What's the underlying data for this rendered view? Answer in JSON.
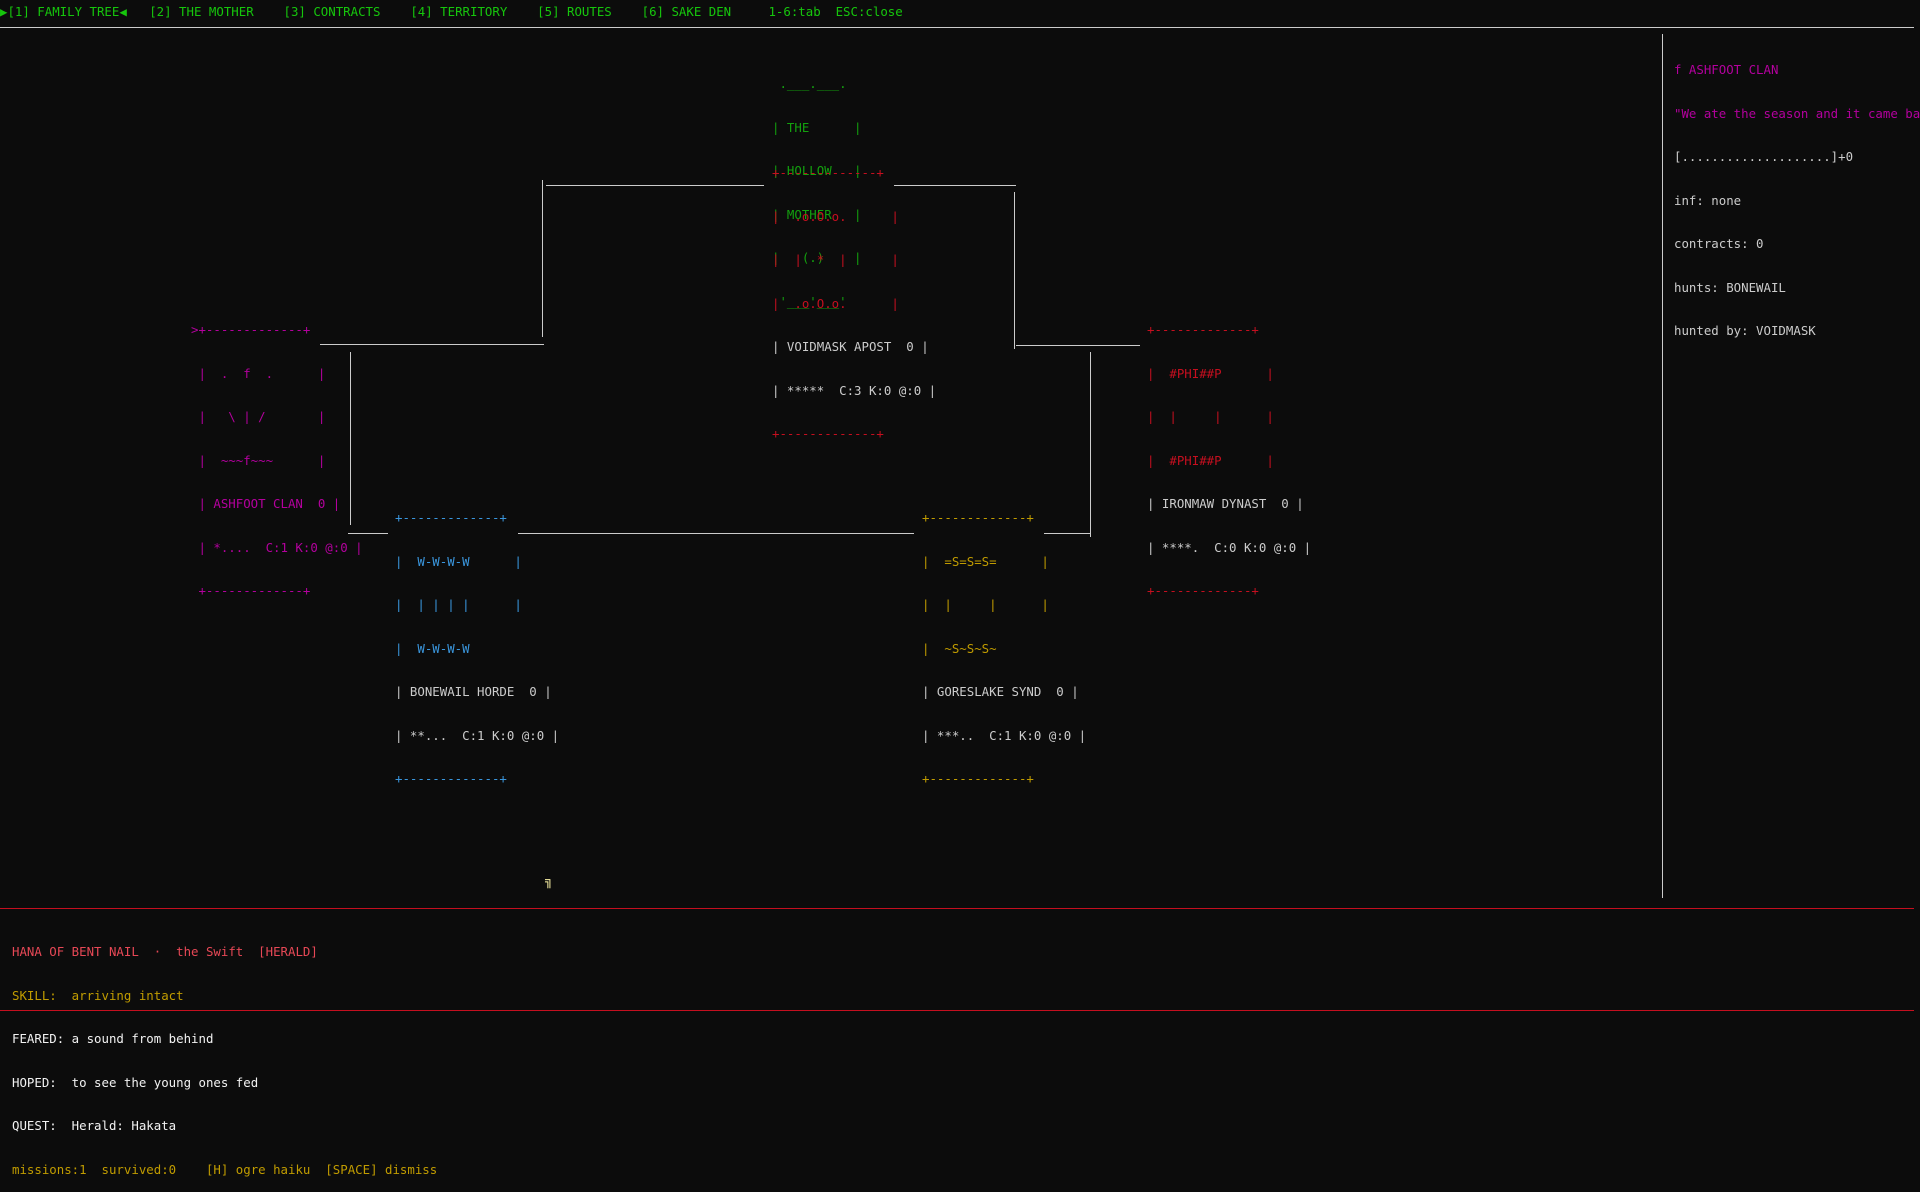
{
  "tabs": {
    "family_tree": "▶[1] FAMILY TREE◀",
    "mother": "[2] THE MOTHER",
    "contracts": "[3] CONTRACTS",
    "territory": "[4] TERRITORY",
    "routes": "[5] ROUTES",
    "sake_den": "[6] SAKE DEN",
    "hint": "1-6:tab  ESC:close"
  },
  "mother_art": [
    " .___.___.",
    "| THE      |",
    "| HOLLOW   |",
    "| MOTHER   |",
    "|   (.)    |",
    " '___'___'"
  ],
  "clans": {
    "voidmask": {
      "art": [
        "+-------------+",
        "|  .o.O.o.      |",
        "|  |  *  |      |",
        "|  .o.O.o.      |"
      ],
      "name_line": "| VOIDMASK APOST  0 |",
      "stats_line": "| *****  C:3 K:0 @:0 |",
      "bottom": "+-------------+"
    },
    "ashfoot": {
      "art": [
        ">+-------------+",
        " |  .  f  .      |",
        " |   \\ | /       |",
        " |  ~~~f~~~      |"
      ],
      "name_line": " | ASHFOOT CLAN  0 |",
      "stats_line": " | *....  C:1 K:0 @:0 |",
      "bottom": " +-------------+"
    },
    "ironmaw": {
      "art": [
        "+-------------+",
        "|  #PHI##P      |",
        "|  |     |      |",
        "|  #PHI##P      |"
      ],
      "name_line": "| IRONMAW DYNAST  0 |",
      "stats_line": "| ****.  C:0 K:0 @:0 |",
      "bottom": "+-------------+"
    },
    "bonewail": {
      "art": [
        "+-------------+",
        "|  W-W-W-W      |",
        "|  | | | |      |",
        "|  W-W-W-W      "
      ],
      "name_line": "| BONEWAIL HORDE  0 |",
      "stats_line": "| **...  C:1 K:0 @:0 |",
      "bottom": "+-------------+"
    },
    "goreslake": {
      "art": [
        "+-------------+",
        "|  =S=S=S=      |",
        "|  |     |      |",
        "|  ~S~S~S~      "
      ],
      "name_line": "| GORESLAKE SYND  0 |",
      "stats_line": "| ***..  C:1 K:0 @:0 |",
      "bottom": "+-------------+"
    }
  },
  "sidebar": {
    "title": "f ASHFOOT CLAN",
    "quote": "\"We ate the season and it came bac",
    "bar": "[....................]+0",
    "inf": "inf: none",
    "contracts": "contracts: 0",
    "hunts": "hunts: BONEWAIL",
    "hunted_by": "hunted by: VOIDMASK"
  },
  "cursor_glyph": "╗",
  "herald": {
    "title": "HANA OF BENT NAIL  ·  the Swift  [HERALD]",
    "skill": "SKILL:  arriving intact",
    "feared": "FEARED: a sound from behind",
    "hoped": "HOPED:  to see the young ones fed",
    "quest": "QUEST:  Herald: Hakata",
    "footer": "missions:1  survived:0    [H] ogre haiku  [SPACE] dismiss"
  },
  "colors": {
    "voidmask": "#c50f1f",
    "ashfoot": "#b4009e",
    "ironmaw": "#c50f1f",
    "bonewail": "#3a96dd",
    "goreslake": "#c19c00",
    "mother": "#13a10e",
    "tabs": "#16c60c"
  }
}
